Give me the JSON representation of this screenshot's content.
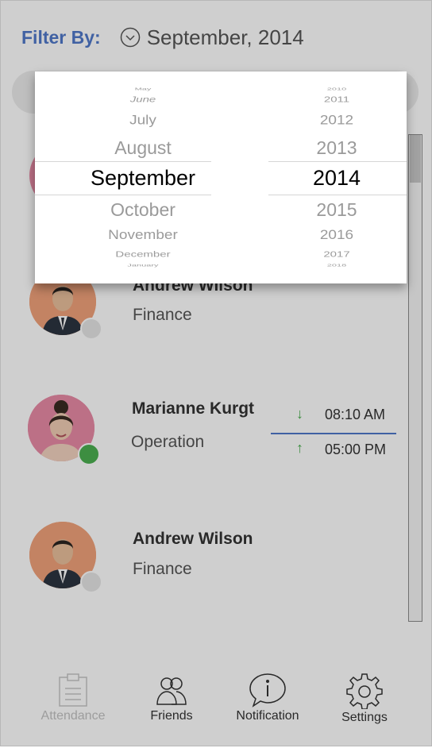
{
  "header": {
    "filter_label": "Filter By:",
    "filter_value": "September, 2014"
  },
  "employees": [
    {
      "name": "Andrew Wilson",
      "department": "Finance",
      "status": "offline",
      "gender": "male"
    },
    {
      "name": "Marianne Kurgt",
      "department": "Operation",
      "status": "online",
      "gender": "female",
      "check_in": "08:10 AM",
      "check_out": "05:00 PM"
    },
    {
      "name": "Andrew Wilson",
      "department": "Finance",
      "status": "offline",
      "gender": "male"
    }
  ],
  "picker": {
    "months": [
      "May",
      "June",
      "July",
      "August",
      "September",
      "October",
      "November",
      "December",
      "January"
    ],
    "years": [
      "2010",
      "2011",
      "2012",
      "2013",
      "2014",
      "2015",
      "2016",
      "2017",
      "2018"
    ],
    "selected_month": "September",
    "selected_year": "2014"
  },
  "tabs": [
    {
      "label": "Attendance",
      "icon": "clipboard-icon",
      "active": false
    },
    {
      "label": "Friends",
      "icon": "friends-icon",
      "active": true
    },
    {
      "label": "Notification",
      "icon": "info-icon",
      "active": true
    },
    {
      "label": "Settings",
      "icon": "gear-icon",
      "active": true
    }
  ],
  "colors": {
    "accent": "#4f78c9",
    "online": "#4caf50",
    "offline": "#e6e6e6",
    "check_in_arrow": "#4caf50",
    "check_out_arrow": "#4caf50"
  }
}
